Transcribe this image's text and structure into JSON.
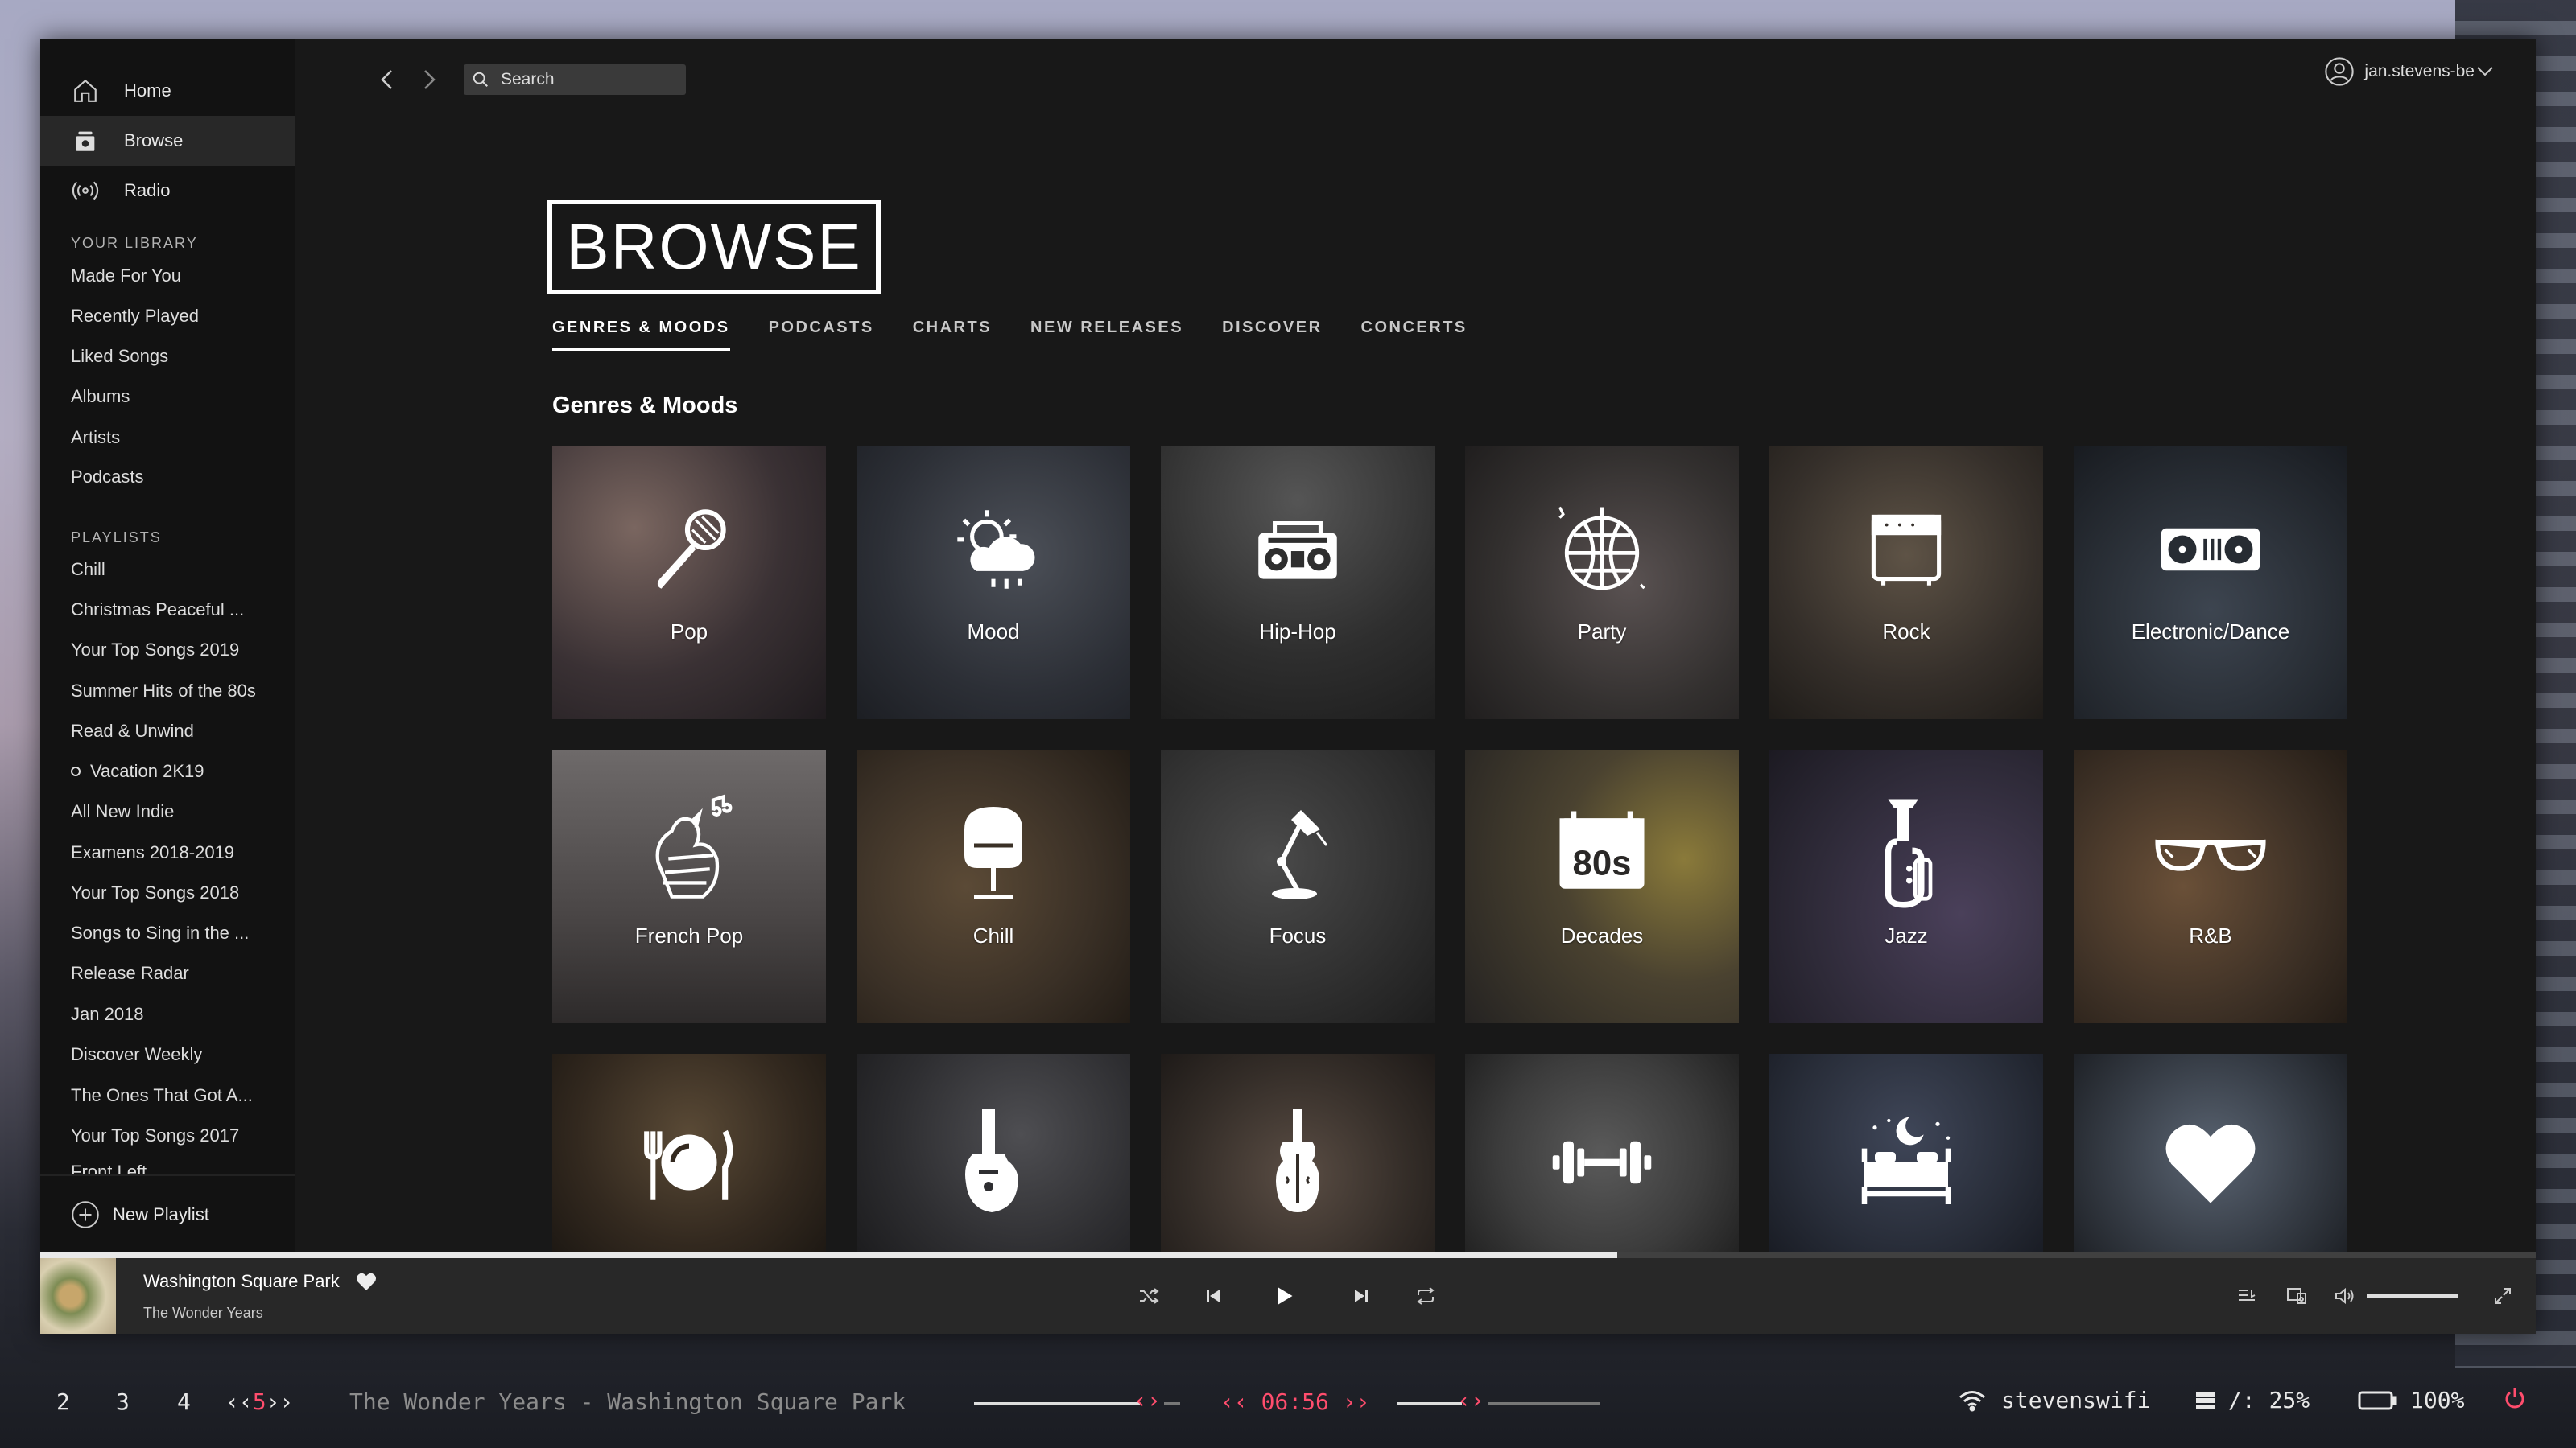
{
  "sidebar": {
    "nav": [
      {
        "label": "Home",
        "icon": "home-icon"
      },
      {
        "label": "Browse",
        "icon": "browse-icon"
      },
      {
        "label": "Radio",
        "icon": "radio-icon"
      }
    ],
    "library_title": "YOUR LIBRARY",
    "library": [
      "Made For You",
      "Recently Played",
      "Liked Songs",
      "Albums",
      "Artists",
      "Podcasts"
    ],
    "playlists_title": "PLAYLISTS",
    "playlists": [
      "Chill",
      "Christmas Peaceful ...",
      "Your Top Songs 2019",
      "Summer Hits of the 80s",
      "Read & Unwind",
      "Vacation 2K19",
      "All New Indie",
      "Examens 2018-2019",
      "Your Top Songs 2018",
      "Songs to Sing in the ...",
      "Release Radar",
      "Jan 2018",
      "Discover Weekly",
      "The Ones That Got A...",
      "Your Top Songs 2017",
      "Front Left"
    ],
    "new_playlist": "New Playlist"
  },
  "topbar": {
    "search_placeholder": "Search",
    "username": "jan.stevens-be"
  },
  "browse": {
    "title": "BROWSE",
    "tabs": [
      "GENRES & MOODS",
      "PODCASTS",
      "CHARTS",
      "NEW RELEASES",
      "DISCOVER",
      "CONCERTS"
    ],
    "active_tab": "GENRES & MOODS",
    "section_title": "Genres & Moods",
    "tiles": [
      {
        "label": "Pop",
        "icon": "microphone-icon"
      },
      {
        "label": "Mood",
        "icon": "sun-cloud-icon"
      },
      {
        "label": "Hip-Hop",
        "icon": "boombox-icon"
      },
      {
        "label": "Party",
        "icon": "disco-ball-icon"
      },
      {
        "label": "Rock",
        "icon": "amplifier-icon"
      },
      {
        "label": "Electronic/Dance",
        "icon": "turntable-icon"
      },
      {
        "label": "French Pop",
        "icon": "rooster-icon"
      },
      {
        "label": "Chill",
        "icon": "egg-chair-icon"
      },
      {
        "label": "Focus",
        "icon": "desk-lamp-icon"
      },
      {
        "label": "Decades",
        "icon": "calendar-80s-icon"
      },
      {
        "label": "Jazz",
        "icon": "saxophone-icon"
      },
      {
        "label": "R&B",
        "icon": "sunglasses-icon"
      },
      {
        "label": "",
        "icon": "dinner-plate-icon"
      },
      {
        "label": "",
        "icon": "electric-guitar-icon"
      },
      {
        "label": "",
        "icon": "violin-icon"
      },
      {
        "label": "",
        "icon": "dumbbell-icon"
      },
      {
        "label": "",
        "icon": "bed-moon-icon"
      },
      {
        "label": "",
        "icon": "heart-icon"
      }
    ],
    "decades_badge": "80s"
  },
  "player": {
    "track": "Washington Square Park",
    "artist": "The Wonder Years",
    "progress": 0.632,
    "volume": 1.0
  },
  "statusbar": {
    "workspaces": [
      "2",
      "3",
      "4"
    ],
    "active_workspace": "5",
    "now_playing": "The Wonder Years - Washington Square Park",
    "time": "06:56",
    "wifi": "stevenswifi",
    "disk": "/: 25%",
    "battery": "100%"
  },
  "colors": {
    "accent_red": "#ff4d6d",
    "window_bg": "#181818",
    "sidebar_bg": "#121212",
    "player_bg": "#282828"
  }
}
